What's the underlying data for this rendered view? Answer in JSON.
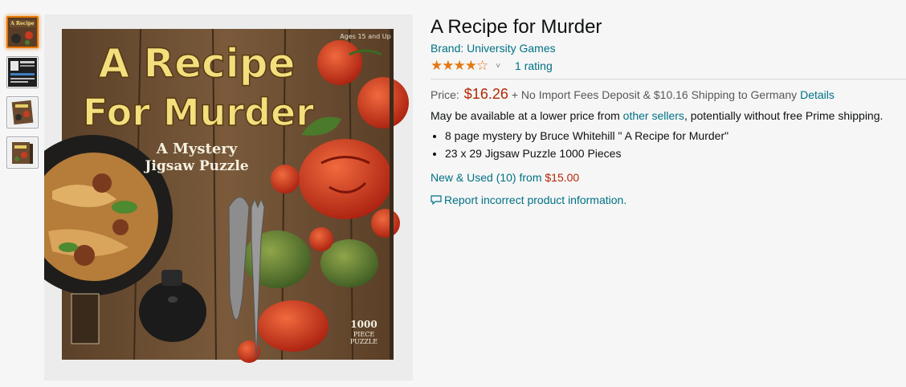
{
  "product": {
    "title": "A Recipe for Murder",
    "brand_label": "Brand: University Games",
    "stars": "★★★★☆",
    "rating_value": 4.0,
    "rating_chevron": "˅",
    "ratings_count_label": "1 rating",
    "price_label": "Price:",
    "price": "$16.26",
    "shipping_text": "+ No Import Fees Deposit & $10.16 Shipping to Germany",
    "details_link": "Details",
    "availability_prefix": "May be available at a lower price from",
    "other_sellers_link": "other sellers",
    "availability_suffix": ", potentially without free Prime shipping.",
    "bullets": [
      "8 page mystery by Bruce Whitehill \" A Recipe for Murder\"",
      "23 x 29 Jigsaw Puzzle 1000 Pieces"
    ],
    "new_used_label": "New & Used (10) from",
    "new_used_price": "$15.00",
    "report_link": "Report incorrect product information."
  },
  "image": {
    "box_title_line1": "A Recipe",
    "box_title_line2": "For Murder",
    "box_subtitle_line1": "A Mystery",
    "box_subtitle_line2": "Jigsaw Puzzle",
    "box_pieces_line1": "1000",
    "box_pieces_line2": "PIECE",
    "box_pieces_line3": "PUZZLE",
    "box_age": "Ages 15 and Up",
    "thumbnail_count": 4
  },
  "colors": {
    "link": "#007185",
    "price": "#b12704",
    "star": "#e47911",
    "thumb_selected": "#e77600"
  }
}
